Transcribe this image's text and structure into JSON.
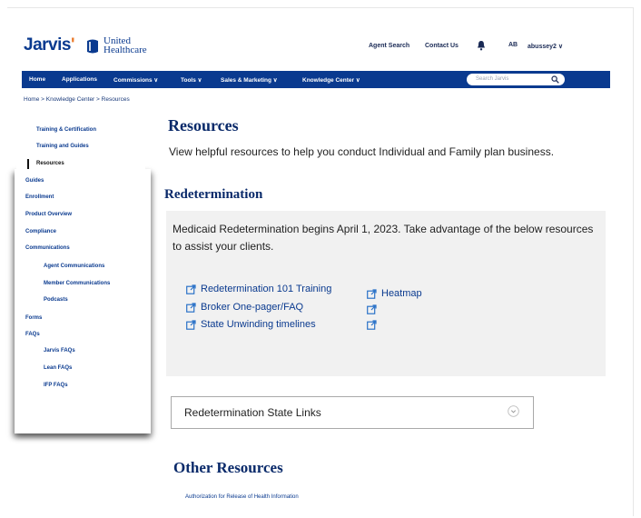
{
  "header": {
    "logo_text": "Jarvis",
    "partner_line1": "United",
    "partner_line2": "Healthcare",
    "links": [
      "Agent Search",
      "Contact Us"
    ],
    "avatar_initials": "AB",
    "username": "abussey2 ∨"
  },
  "nav": {
    "items": [
      "Home",
      "Applications",
      "Commissions ∨",
      "Tools ∨",
      "Sales & Marketing ∨",
      "Knowledge Center ∨"
    ],
    "search_placeholder": "Search Jarvis"
  },
  "breadcrumb": "Home  >  Knowledge Center  >  Resources",
  "sidebar": {
    "items": [
      "Training & Certification",
      "Training and Guides",
      "Resources",
      "Guides",
      "Enrollment",
      "Product Overview",
      "Compliance",
      "Communications",
      "Agent Communications",
      "Member Communications",
      "Podcasts",
      "Forms",
      "FAQs",
      "Jarvis FAQs",
      "Lean FAQs",
      "IFP FAQs"
    ]
  },
  "main": {
    "title": "Resources",
    "lead": "View helpful resources to help you conduct Individual and Family plan business.",
    "section_title": "Redetermination",
    "panel_text": "Medicaid Redetermination begins April 1, 2023. Take advantage of the below resources to assist your clients.",
    "links_left": [
      "Redetermination 101 Training",
      "Broker One-pager/FAQ",
      "State Unwinding timelines"
    ],
    "links_right": [
      "Heatmap",
      "",
      ""
    ],
    "accordion_label": "Redetermination State Links",
    "other_title": "Other Resources",
    "other_links": [
      "Authorization for Release of Health Information"
    ]
  },
  "colors": {
    "brand_blue": "#0a3a8f",
    "logo_orange": "#ea7a2a",
    "panel_bg": "#f1f1f1"
  }
}
